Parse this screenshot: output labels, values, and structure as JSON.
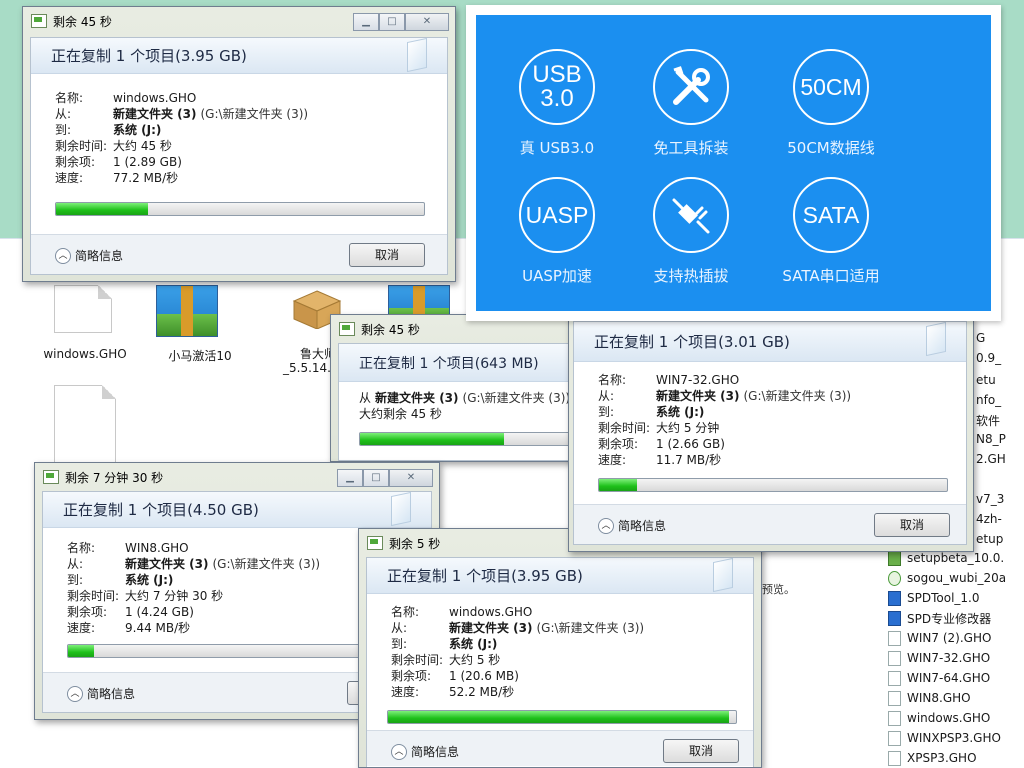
{
  "explorer": {
    "files": [
      {
        "label": "windows.GHO"
      },
      {
        "label": "小马激活10"
      },
      {
        "label": "鲁大师"
      },
      {
        "label": "_5.5.14.1"
      }
    ],
    "right_list": [
      {
        "label": "setupbeta_10.0.",
        "icon": "app"
      },
      {
        "label": "sogou_wubi_20a",
        "icon": "sogou"
      },
      {
        "label": "SPDTool_1.0",
        "icon": "spd"
      },
      {
        "label": "SPD专业修改器",
        "icon": "spd"
      },
      {
        "label": "WIN7 (2).GHO",
        "icon": "doc"
      },
      {
        "label": "WIN7-32.GHO",
        "icon": "doc"
      },
      {
        "label": "WIN7-64.GHO",
        "icon": "doc"
      },
      {
        "label": "WIN8.GHO",
        "icon": "doc"
      },
      {
        "label": "windows.GHO",
        "icon": "doc"
      },
      {
        "label": "WINXPSP3.GHO",
        "icon": "doc"
      },
      {
        "label": "XPSP3.GHO",
        "icon": "doc"
      }
    ],
    "cut_items": [
      "G",
      "0.9_",
      "etu",
      "nfo_",
      "软件",
      "N8_P",
      "2.GH",
      "v7_3",
      "4zh-",
      "etup"
    ],
    "stray_text": "预览。"
  },
  "dialogs": [
    {
      "title": "剩余 45 秒",
      "header": "正在复制 1 个项目(3.95 GB)",
      "name_label": "名称:",
      "name": "windows.GHO",
      "from_label": "从:",
      "from": "新建文件夹 (3)",
      "from_path": "(G:\\新建文件夹 (3))",
      "to_label": "到:",
      "to": "系统 (J:)",
      "time_label": "剩余时间:",
      "time": "大约 45 秒",
      "items_label": "剩余项:",
      "items": "1 (2.89 GB)",
      "speed_label": "速度:",
      "speed": "77.2 MB/秒",
      "progress": 0.25,
      "more": "简略信息",
      "cancel": "取消"
    },
    {
      "title": "剩余 45 秒",
      "header": "正在复制 1 个项目(643 MB)",
      "from_prefix": "从",
      "from": "新建文件夹 (3)",
      "from_path": "(G:\\新建文件夹 (3))",
      "remain": "大约剩余 45 秒",
      "progress": 0.58
    },
    {
      "header": "正在复制 1 个项目(3.01 GB)",
      "name_label": "名称:",
      "name": "WIN7-32.GHO",
      "from_label": "从:",
      "from": "新建文件夹 (3)",
      "from_path": "(G:\\新建文件夹 (3))",
      "to_label": "到:",
      "to": "系统 (J:)",
      "time_label": "剩余时间:",
      "time": "大约 5 分钟",
      "items_label": "剩余项:",
      "items": "1 (2.66 GB)",
      "speed_label": "速度:",
      "speed": "11.7 MB/秒",
      "progress": 0.11,
      "more": "简略信息",
      "cancel": "取消"
    },
    {
      "title": "剩余 7 分钟 30 秒",
      "header": "正在复制 1 个项目(4.50 GB)",
      "name_label": "名称:",
      "name": "WIN8.GHO",
      "from_label": "从:",
      "from": "新建文件夹 (3)",
      "from_path": "(G:\\新建文件夹 (3))",
      "to_label": "到:",
      "to": "系统 (J:)",
      "time_label": "剩余时间:",
      "time": "大约 7 分钟 30 秒",
      "items_label": "剩余项:",
      "items": "1 (4.24 GB)",
      "speed_label": "速度:",
      "speed": "9.44 MB/秒",
      "progress": 0.07,
      "more": "简略信息"
    },
    {
      "title": "剩余 5 秒",
      "header": "正在复制 1 个项目(3.95 GB)",
      "name_label": "名称:",
      "name": "windows.GHO",
      "from_label": "从:",
      "from": "新建文件夹 (3)",
      "from_path": "(G:\\新建文件夹 (3))",
      "to_label": "到:",
      "to": "系统 (J:)",
      "time_label": "剩余时间:",
      "time": "大约 5 秒",
      "items_label": "剩余项:",
      "items": "1 (20.6 MB)",
      "speed_label": "速度:",
      "speed": "52.2 MB/秒",
      "progress": 0.98,
      "more": "简略信息",
      "cancel": "取消"
    }
  ],
  "features": {
    "bg_color": "#1b8ff0",
    "items": [
      {
        "icon_text": "USB\n3.0",
        "caption": "真 USB3.0"
      },
      {
        "icon": "tools-icon",
        "caption": "免工具拆装"
      },
      {
        "icon_text": "50CM",
        "caption": "50CM数据线"
      },
      {
        "icon_text": "UASP",
        "caption": "UASP加速"
      },
      {
        "icon": "plug-icon",
        "caption": "支持热插拔"
      },
      {
        "icon_text": "SATA",
        "caption": "SATA串口适用"
      }
    ]
  }
}
